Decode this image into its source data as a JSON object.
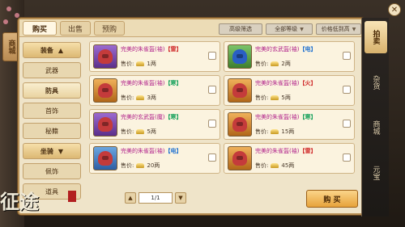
{
  "window": {
    "left_tab": "商城",
    "close_glyph": "✕"
  },
  "top_tabs": [
    {
      "label": "购买",
      "active": true
    },
    {
      "label": "出售",
      "active": false
    },
    {
      "label": "预购",
      "active": false
    }
  ],
  "filters": {
    "advanced": "高级筛选",
    "level": "全部等级",
    "sort": "价格低到高"
  },
  "categories": [
    {
      "label": "装备",
      "expanded": true,
      "head": true
    },
    {
      "label": "武器",
      "active": false
    },
    {
      "label": "防具",
      "active": true
    },
    {
      "label": "首饰",
      "active": false
    },
    {
      "label": "秘籍",
      "active": false
    },
    {
      "label": "坐骑",
      "head": true
    },
    {
      "label": "佩饰",
      "active": false
    },
    {
      "label": "道具",
      "active": false
    }
  ],
  "items": [
    {
      "name_prefix": "完美的朱雀盔(袖)",
      "tag": "【雷】",
      "tag_color": "#d02b2b",
      "price_label": "售价:",
      "price": "1两",
      "icon_color": "purple"
    },
    {
      "name_prefix": "完美的玄武盔(袖)",
      "tag": "【电】",
      "tag_color": "#1d6fd0",
      "price_label": "售价:",
      "price": "2两",
      "icon_color": "green"
    },
    {
      "name_prefix": "完美的朱雀盔(袖)",
      "tag": "【寒】",
      "tag_color": "#14a05a",
      "price_label": "售价:",
      "price": "3两",
      "icon_color": "orange"
    },
    {
      "name_prefix": "完美的朱雀盔(袖)",
      "tag": "【火】",
      "tag_color": "#d02b2b",
      "price_label": "售价:",
      "price": "5两",
      "icon_color": "orange"
    },
    {
      "name_prefix": "完美的玄武盔(魔)",
      "tag": "【寒】",
      "tag_color": "#14a05a",
      "price_label": "售价:",
      "price": "5两",
      "icon_color": "purple"
    },
    {
      "name_prefix": "完美的朱雀盔(袖)",
      "tag": "【寒】",
      "tag_color": "#14a05a",
      "price_label": "售价:",
      "price": "15两",
      "icon_color": "orange"
    },
    {
      "name_prefix": "完美的朱雀盔(袖)",
      "tag": "【电】",
      "tag_color": "#1d6fd0",
      "price_label": "售价:",
      "price": "20两",
      "icon_color": "blue"
    },
    {
      "name_prefix": "完美的朱雀盔(袖)",
      "tag": "【雷】",
      "tag_color": "#d02b2b",
      "price_label": "售价:",
      "price": "45两",
      "icon_color": "orange"
    }
  ],
  "pager": {
    "prev": "▲",
    "next": "▼",
    "page": "1/1"
  },
  "buy_button": "购 买",
  "right_tabs": [
    {
      "label": "拍卖",
      "active": true
    },
    {
      "label": "杂货",
      "active": false
    },
    {
      "label": "商城",
      "active": false
    },
    {
      "label": "元宝",
      "active": false
    }
  ],
  "logo_text": "征途"
}
